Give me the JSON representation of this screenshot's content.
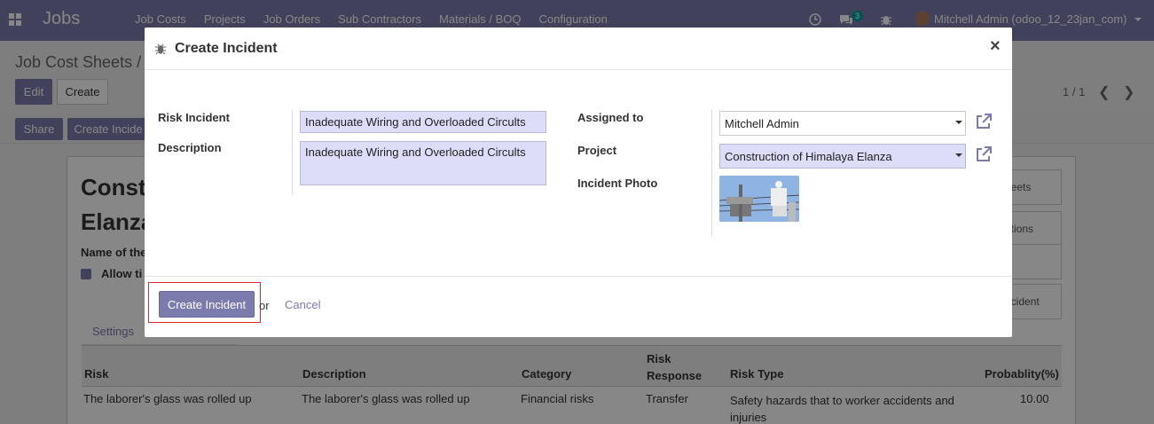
{
  "navbar": {
    "app_title": "Jobs",
    "menu": [
      "Job Costs",
      "Projects",
      "Job Orders",
      "Sub Contractors",
      "Materials / BOQ",
      "Configuration"
    ],
    "message_count": "3",
    "user": "Mitchell Admin (odoo_12_23jan_com)"
  },
  "background": {
    "breadcrumb": "Job Cost Sheets /",
    "edit_label": "Edit",
    "create_label": "Create",
    "pager": "1 / 1",
    "share_label": "Share",
    "create_incident_label": "Create Incide",
    "record_title_line1": "Const",
    "record_title_line2": "Elanza",
    "name_label": "Name of the",
    "allow_label": "Allow ti",
    "smart_buttons": [
      "heets",
      "ations",
      "ncident"
    ],
    "tab_settings": "Settings",
    "table": {
      "headers": [
        "Risk",
        "Description",
        "Category",
        "Risk\nResponse",
        "Risk Type",
        "Probablity(%)"
      ],
      "row": [
        "The laborer's glass was rolled up",
        "The laborer's glass was rolled up",
        "Financial risks",
        "Transfer",
        "Safety hazards that to worker accidents and injuries",
        "10.00"
      ]
    }
  },
  "modal": {
    "title": "Create Incident",
    "close": "×",
    "left": {
      "risk_incident_label": "Risk Incident",
      "risk_incident_value": "Inadequate Wiring and Overloaded Circults",
      "description_label": "Description",
      "description_value": "Inadequate Wiring and Overloaded Circults"
    },
    "right": {
      "assigned_to_label": "Assigned to",
      "assigned_to_value": "Mitchell Admin",
      "project_label": "Project",
      "project_value": "Construction of Himalaya Elanza",
      "photo_label": "Incident Photo"
    },
    "footer": {
      "create_label": "Create Incident",
      "or_label": "or",
      "cancel_label": "Cancel"
    }
  },
  "colors": {
    "brand": "#7c7bad",
    "required_field": "#ddddf9",
    "highlight": "#e0262f"
  }
}
